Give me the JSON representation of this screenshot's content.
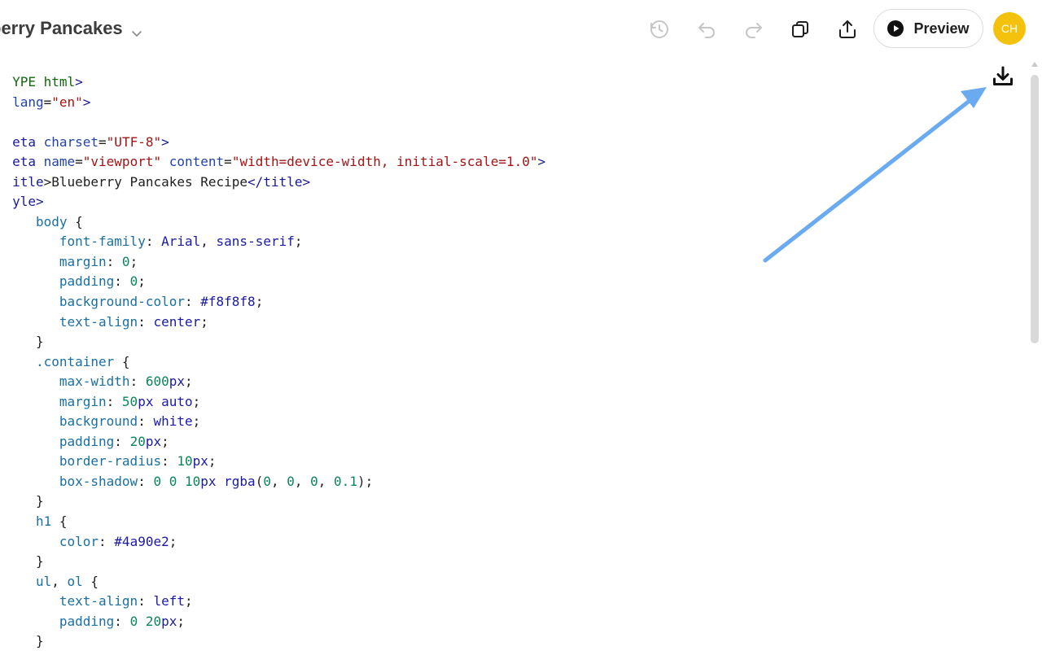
{
  "header": {
    "doc_title": "berry Pancakes",
    "preview_label": "Preview",
    "avatar_initials": "CH"
  },
  "toolbar": {
    "icons": [
      "history-icon",
      "undo-icon",
      "redo-icon",
      "copy-icon",
      "share-icon"
    ]
  },
  "colors": {
    "avatar": "#f4c20d",
    "annotation_arrow": "#6aaaf0"
  },
  "code": {
    "lines": [
      [
        [
          "kw",
          "YPE html"
        ],
        [
          "tag",
          ">"
        ]
      ],
      [
        [
          "attr",
          "lang"
        ],
        [
          "",
          "="
        ],
        [
          "str",
          "\"en\""
        ],
        [
          "tag",
          ">"
        ]
      ],
      [],
      [
        [
          "tag",
          "eta "
        ],
        [
          "attr",
          "charset"
        ],
        [
          "",
          "="
        ],
        [
          "str",
          "\"UTF-8\""
        ],
        [
          "tag",
          ">"
        ]
      ],
      [
        [
          "tag",
          "eta "
        ],
        [
          "attr",
          "name"
        ],
        [
          "",
          "="
        ],
        [
          "str",
          "\"viewport\""
        ],
        [
          "",
          " "
        ],
        [
          "attr",
          "content"
        ],
        [
          "",
          "="
        ],
        [
          "str",
          "\"width=device-width, initial-scale=1.0\""
        ],
        [
          "tag",
          ">"
        ]
      ],
      [
        [
          "tag",
          "itle"
        ],
        [
          "",
          ">Blueberry Pancakes Recipe"
        ],
        [
          "tag",
          "</title>"
        ]
      ],
      [
        [
          "tag",
          "yle"
        ],
        [
          "tag",
          ">"
        ]
      ],
      [
        [
          "",
          " "
        ],
        [
          "sel",
          "  body"
        ],
        [
          "",
          " {"
        ]
      ],
      [
        [
          "",
          "      "
        ],
        [
          "prop",
          "font-family"
        ],
        [
          "",
          ": "
        ],
        [
          "val",
          "Arial"
        ],
        [
          "",
          ", "
        ],
        [
          "val",
          "sans-serif"
        ],
        [
          "",
          ";"
        ]
      ],
      [
        [
          "",
          "      "
        ],
        [
          "prop",
          "margin"
        ],
        [
          "",
          ": "
        ],
        [
          "num",
          "0"
        ],
        [
          "",
          ";"
        ]
      ],
      [
        [
          "",
          "      "
        ],
        [
          "prop",
          "padding"
        ],
        [
          "",
          ": "
        ],
        [
          "num",
          "0"
        ],
        [
          "",
          ";"
        ]
      ],
      [
        [
          "",
          "      "
        ],
        [
          "prop",
          "background-color"
        ],
        [
          "",
          ": "
        ],
        [
          "val",
          "#f8f8f8"
        ],
        [
          "",
          ";"
        ]
      ],
      [
        [
          "",
          "      "
        ],
        [
          "prop",
          "text-align"
        ],
        [
          "",
          ": "
        ],
        [
          "val",
          "center"
        ],
        [
          "",
          ";"
        ]
      ],
      [
        [
          "",
          "   }"
        ]
      ],
      [
        [
          "",
          "   "
        ],
        [
          "sel",
          ".container"
        ],
        [
          "",
          " {"
        ]
      ],
      [
        [
          "",
          "      "
        ],
        [
          "prop",
          "max-width"
        ],
        [
          "",
          ": "
        ],
        [
          "num",
          "600"
        ],
        [
          "val",
          "px"
        ],
        [
          "",
          ";"
        ]
      ],
      [
        [
          "",
          "      "
        ],
        [
          "prop",
          "margin"
        ],
        [
          "",
          ": "
        ],
        [
          "num",
          "50"
        ],
        [
          "val",
          "px auto"
        ],
        [
          "",
          ";"
        ]
      ],
      [
        [
          "",
          "      "
        ],
        [
          "prop",
          "background"
        ],
        [
          "",
          ": "
        ],
        [
          "val",
          "white"
        ],
        [
          "",
          ";"
        ]
      ],
      [
        [
          "",
          "      "
        ],
        [
          "prop",
          "padding"
        ],
        [
          "",
          ": "
        ],
        [
          "num",
          "20"
        ],
        [
          "val",
          "px"
        ],
        [
          "",
          ";"
        ]
      ],
      [
        [
          "",
          "      "
        ],
        [
          "prop",
          "border-radius"
        ],
        [
          "",
          ": "
        ],
        [
          "num",
          "10"
        ],
        [
          "val",
          "px"
        ],
        [
          "",
          ";"
        ]
      ],
      [
        [
          "",
          "      "
        ],
        [
          "prop",
          "box-shadow"
        ],
        [
          "",
          ": "
        ],
        [
          "num",
          "0 0 10"
        ],
        [
          "val",
          "px"
        ],
        [
          "",
          " "
        ],
        [
          "val",
          "rgba"
        ],
        [
          "",
          "("
        ],
        [
          "num",
          "0"
        ],
        [
          "",
          ", "
        ],
        [
          "num",
          "0"
        ],
        [
          "",
          ", "
        ],
        [
          "num",
          "0"
        ],
        [
          "",
          ", "
        ],
        [
          "num",
          "0.1"
        ],
        [
          "",
          ");"
        ]
      ],
      [
        [
          "",
          "   }"
        ]
      ],
      [
        [
          "",
          "   "
        ],
        [
          "sel",
          "h1"
        ],
        [
          "",
          " {"
        ]
      ],
      [
        [
          "",
          "      "
        ],
        [
          "prop",
          "color"
        ],
        [
          "",
          ": "
        ],
        [
          "val",
          "#4a90e2"
        ],
        [
          "",
          ";"
        ]
      ],
      [
        [
          "",
          "   }"
        ]
      ],
      [
        [
          "",
          "   "
        ],
        [
          "sel",
          "ul"
        ],
        [
          "",
          ", "
        ],
        [
          "sel",
          "ol"
        ],
        [
          "",
          " {"
        ]
      ],
      [
        [
          "",
          "      "
        ],
        [
          "prop",
          "text-align"
        ],
        [
          "",
          ": "
        ],
        [
          "val",
          "left"
        ],
        [
          "",
          ";"
        ]
      ],
      [
        [
          "",
          "      "
        ],
        [
          "prop",
          "padding"
        ],
        [
          "",
          ": "
        ],
        [
          "num",
          "0 20"
        ],
        [
          "val",
          "px"
        ],
        [
          "",
          ";"
        ]
      ],
      [
        [
          "",
          "   }"
        ]
      ]
    ]
  }
}
